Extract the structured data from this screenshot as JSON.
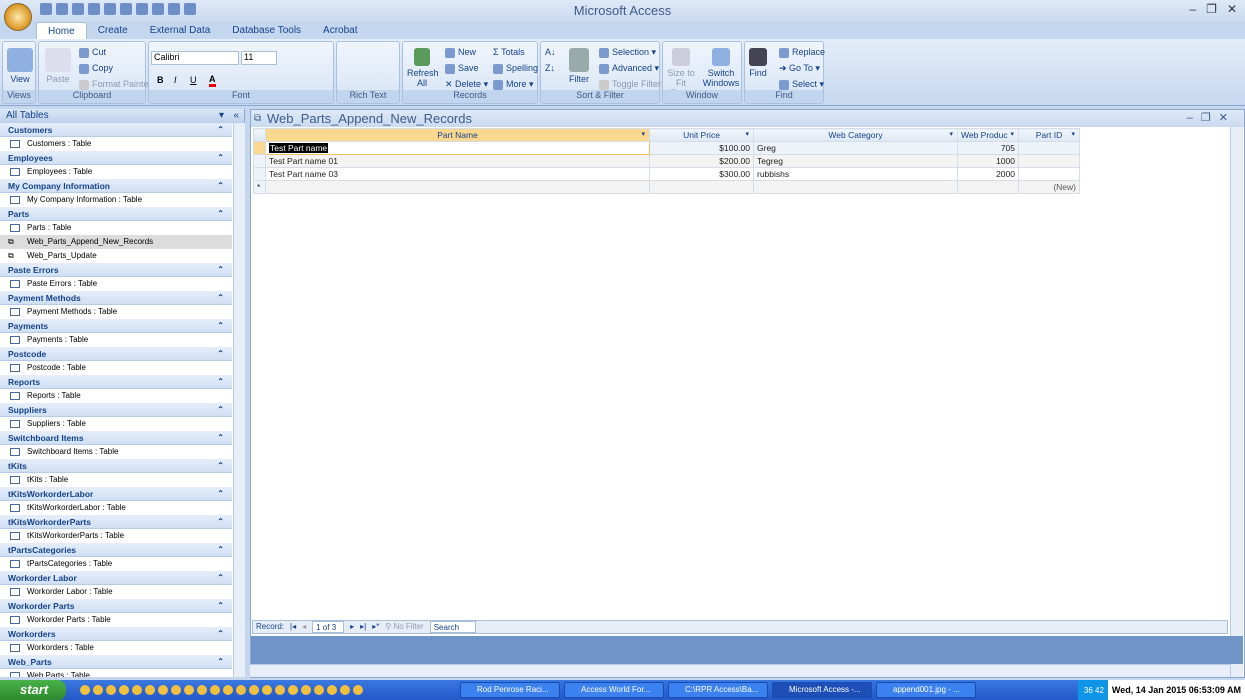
{
  "app": {
    "title": "Microsoft Access"
  },
  "tabs": [
    "Home",
    "Create",
    "External Data",
    "Database Tools",
    "Acrobat"
  ],
  "ribbon": {
    "views": {
      "label": "Views",
      "view": "View"
    },
    "clipboard": {
      "label": "Clipboard",
      "paste": "Paste",
      "cut": "Cut",
      "copy": "Copy",
      "format_painter": "Format Painter"
    },
    "font": {
      "label": "Font",
      "family": "Calibri",
      "size": "11",
      "bold": "B",
      "italic": "I",
      "underline": "U",
      "color": "A"
    },
    "rich_text": {
      "label": "Rich Text"
    },
    "records": {
      "label": "Records",
      "refresh": "Refresh All",
      "new": "New",
      "save": "Save",
      "delete": "Delete",
      "totals": "Totals",
      "spelling": "Spelling",
      "more": "More"
    },
    "sort_filter": {
      "label": "Sort & Filter",
      "filter": "Filter",
      "selection": "Selection",
      "advanced": "Advanced",
      "toggle_filter": "Toggle Filter"
    },
    "window": {
      "label": "Window",
      "size_to_fit": "Size to Fit Form",
      "switch_windows": "Switch Windows"
    },
    "find": {
      "label": "Find",
      "find": "Find",
      "replace": "Replace",
      "go_to": "Go To",
      "select": "Select"
    }
  },
  "nav": {
    "title": "All Tables",
    "groups": [
      {
        "name": "Customers",
        "items": [
          {
            "label": "Customers : Table",
            "type": "table"
          }
        ]
      },
      {
        "name": "Employees",
        "items": [
          {
            "label": "Employees : Table",
            "type": "table"
          }
        ]
      },
      {
        "name": "My Company Information",
        "items": [
          {
            "label": "My Company Information : Table",
            "type": "table"
          }
        ]
      },
      {
        "name": "Parts",
        "items": [
          {
            "label": "Parts : Table",
            "type": "table"
          },
          {
            "label": "Web_Parts_Append_New_Records",
            "type": "query",
            "selected": true
          },
          {
            "label": "Web_Parts_Update",
            "type": "query"
          }
        ]
      },
      {
        "name": "Paste Errors",
        "items": [
          {
            "label": "Paste Errors : Table",
            "type": "table"
          }
        ]
      },
      {
        "name": "Payment Methods",
        "items": [
          {
            "label": "Payment Methods : Table",
            "type": "table"
          }
        ]
      },
      {
        "name": "Payments",
        "items": [
          {
            "label": "Payments : Table",
            "type": "table"
          }
        ]
      },
      {
        "name": "Postcode",
        "items": [
          {
            "label": "Postcode : Table",
            "type": "table"
          }
        ]
      },
      {
        "name": "Reports",
        "items": [
          {
            "label": "Reports : Table",
            "type": "table"
          }
        ]
      },
      {
        "name": "Suppliers",
        "items": [
          {
            "label": "Suppliers : Table",
            "type": "table"
          }
        ]
      },
      {
        "name": "Switchboard Items",
        "items": [
          {
            "label": "Switchboard Items : Table",
            "type": "table"
          }
        ]
      },
      {
        "name": "tKits",
        "items": [
          {
            "label": "tKits : Table",
            "type": "table"
          }
        ]
      },
      {
        "name": "tKitsWorkorderLabor",
        "items": [
          {
            "label": "tKitsWorkorderLabor : Table",
            "type": "table"
          }
        ]
      },
      {
        "name": "tKitsWorkorderParts",
        "items": [
          {
            "label": "tKitsWorkorderParts : Table",
            "type": "table"
          }
        ]
      },
      {
        "name": "tPartsCategories",
        "items": [
          {
            "label": "tPartsCategories : Table",
            "type": "table"
          }
        ]
      },
      {
        "name": "Workorder Labor",
        "items": [
          {
            "label": "Workorder Labor : Table",
            "type": "table"
          }
        ]
      },
      {
        "name": "Workorder Parts",
        "items": [
          {
            "label": "Workorder Parts : Table",
            "type": "table"
          }
        ]
      },
      {
        "name": "Workorders",
        "items": [
          {
            "label": "Workorders : Table",
            "type": "table"
          }
        ]
      },
      {
        "name": "Web_Parts",
        "items": [
          {
            "label": "Web Parts : Table",
            "type": "table"
          }
        ]
      }
    ]
  },
  "document": {
    "title": "Web_Parts_Append_New_Records",
    "columns": [
      "Part Name",
      "Unit Price",
      "Web Category",
      "Web Produc",
      "Part ID"
    ],
    "rows": [
      [
        "Test Part name",
        "$100.00",
        "Greg",
        "705",
        ""
      ],
      [
        "Test Part name 01",
        "$200.00",
        "Tegreg",
        "1000",
        ""
      ],
      [
        "Test Part name 03",
        "$300.00",
        "rubbishs",
        "2000",
        ""
      ]
    ],
    "new_row": {
      "marker": "*",
      "part_id": "(New)"
    }
  },
  "record_nav": {
    "label": "Record:",
    "position": "1 of 3",
    "filter": "No Filter",
    "search": "Search"
  },
  "taskbar": {
    "start": "start",
    "tasks": [
      "Rod Penrose Raci...",
      "Access World For...",
      "C:\\RPR Access\\Ba...",
      "Microsoft Access -...",
      "append001.jpg - ..."
    ],
    "active_task": 3,
    "tray_time": "36 42",
    "clock": "Wed, 14 Jan 2015  06:53:09 AM"
  }
}
